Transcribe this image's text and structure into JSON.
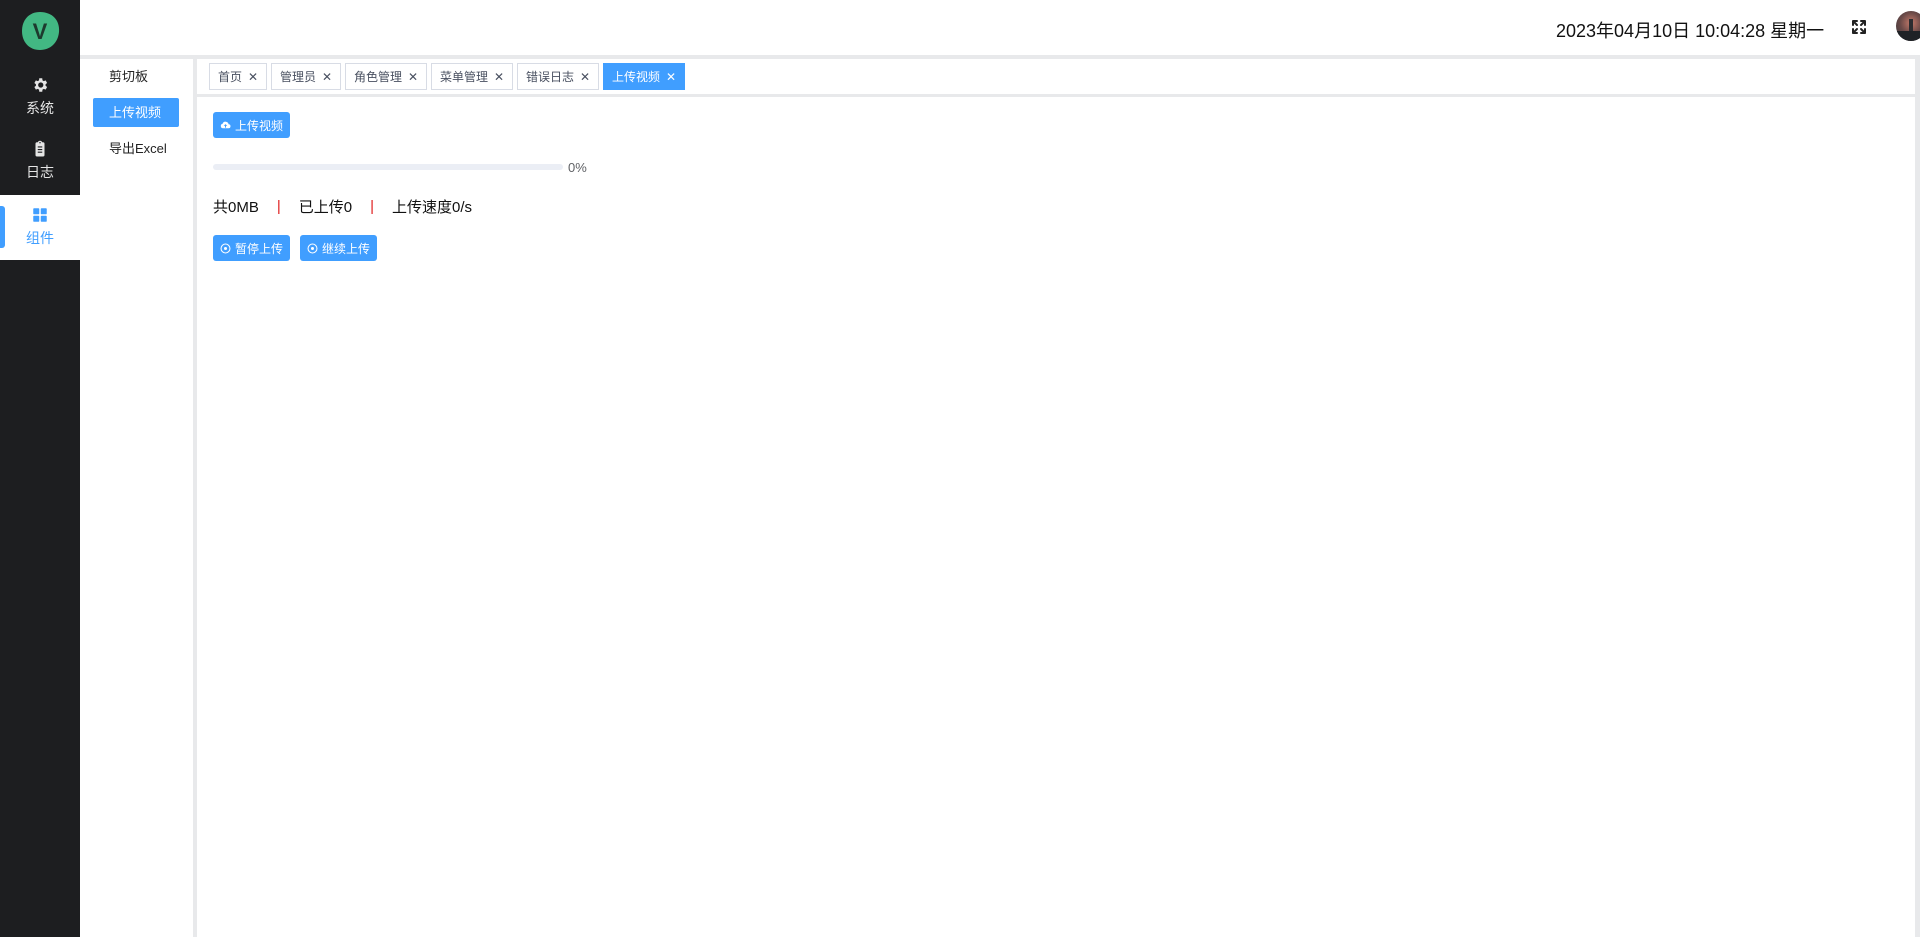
{
  "app": {
    "logo_letter": "V",
    "logo_color": "#42b883"
  },
  "rail": {
    "items": [
      {
        "label": "系统",
        "icon": "gear-icon"
      },
      {
        "label": "日志",
        "icon": "clipboard-icon"
      },
      {
        "label": "组件",
        "icon": "grid-icon",
        "active": true
      }
    ]
  },
  "header": {
    "datetime": "2023年04月10日 10:04:28 星期一",
    "fullscreen_icon": "fullscreen-icon",
    "avatar_icon": "avatar"
  },
  "submenu": {
    "items": [
      {
        "label": "剪切板"
      },
      {
        "label": "上传视频",
        "active": true
      },
      {
        "label": "导出Excel"
      }
    ]
  },
  "tabs": [
    {
      "label": "首页"
    },
    {
      "label": "管理员"
    },
    {
      "label": "角色管理"
    },
    {
      "label": "菜单管理"
    },
    {
      "label": "错误日志"
    },
    {
      "label": "上传视频",
      "active": true
    }
  ],
  "main": {
    "upload_button": "上传视频",
    "progress": {
      "value": 0,
      "text": "0%"
    },
    "stats": {
      "total": "共0MB",
      "uploaded": "已上传0",
      "speed": "上传速度0/s",
      "separator": "|"
    },
    "pause_button": "暂停上传",
    "resume_button": "继续上传"
  },
  "colors": {
    "primary": "#409eff",
    "rail_bg": "#1d1e20",
    "separator": "#e02020"
  }
}
